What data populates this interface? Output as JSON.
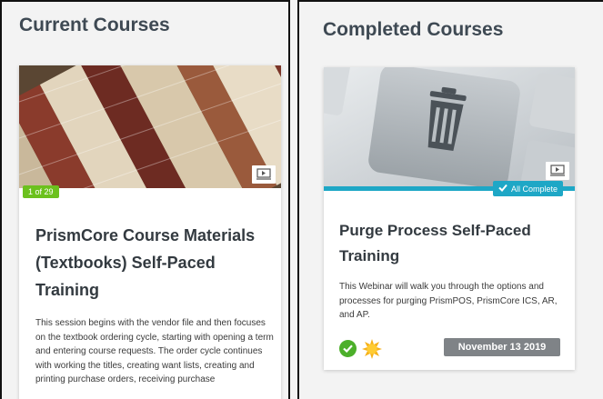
{
  "current": {
    "heading": "Current Courses",
    "course": {
      "progress": "1 of 29",
      "title": "PrismCore Course Materials (Textbooks) Self-Paced Training",
      "description": "This session begins with the vendor file and then focuses on the textbook ordering cycle, starting with opening a term and entering course requests. The order cycle continues with working the titles, creating want lists, creating and printing purchase orders, receiving purchase",
      "media_icon": "presentation-icon"
    }
  },
  "completed": {
    "heading": "Completed Courses",
    "course": {
      "status": "All Complete",
      "title": "Purge Process Self-Paced Training",
      "description": "This Webinar will walk you through the options and processes for purging PrismPOS, PrismCore ICS, AR, and AP.",
      "date": "November 13 2019",
      "media_icon": "presentation-icon",
      "status_icons": [
        "check-circle-icon",
        "sun-badge-icon"
      ]
    }
  },
  "colors": {
    "accent_teal": "#1ea7c6",
    "progress_green": "#6cc11e",
    "heading": "#3e4953",
    "date_badge": "#7f8387"
  }
}
